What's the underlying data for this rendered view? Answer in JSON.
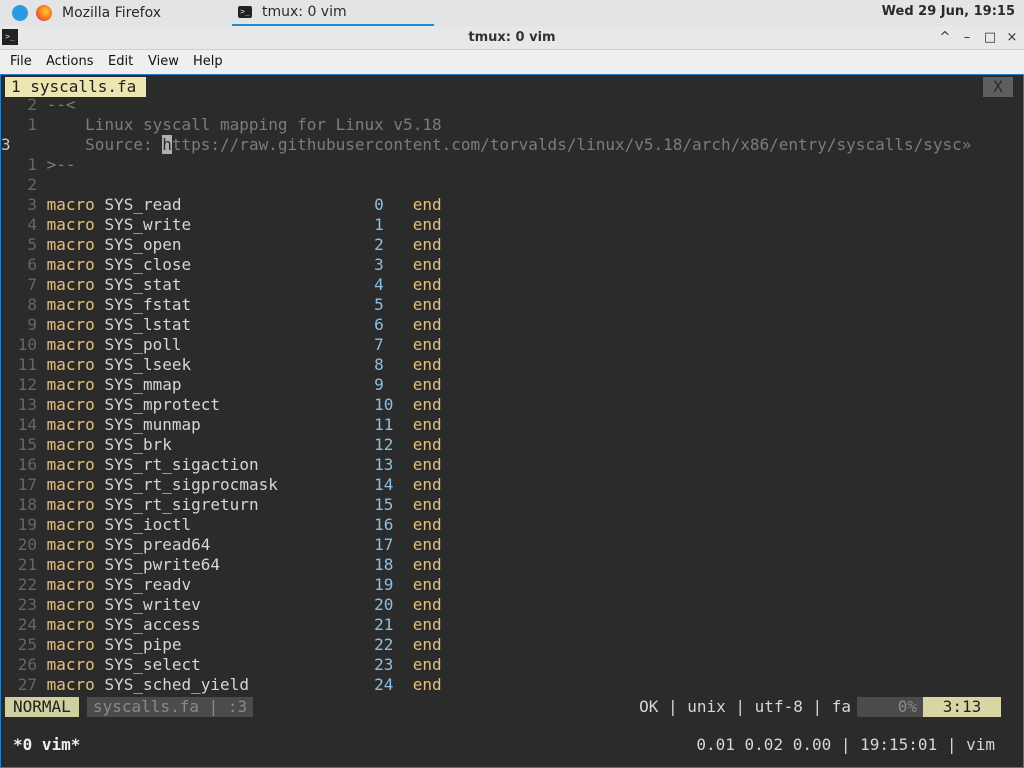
{
  "panel": {
    "task1": "Mozilla Firefox",
    "task2": "tmux: 0 vim",
    "clock": "Wed 29 Jun, 19:15"
  },
  "window": {
    "title": "tmux: 0 vim",
    "minimize": "^",
    "restore": "–",
    "maximize": "□",
    "close": "×"
  },
  "menu": [
    "File",
    "Actions",
    "Edit",
    "View",
    "Help"
  ],
  "vim": {
    "tab_label": "1 syscalls.fa",
    "tab_close": "X",
    "header_lines": [
      {
        "num": "2",
        "text": "--<"
      },
      {
        "num": "1",
        "text": "    Linux syscall mapping for Linux v5.18"
      },
      {
        "num": "3",
        "text": "    Source: https://raw.githubusercontent.com/torvalds/linux/v5.18/arch/x86/entry/syscalls/sysc»",
        "current": true
      },
      {
        "num": "1",
        "text": ">--"
      },
      {
        "num": "2",
        "text": ""
      }
    ],
    "macros": [
      {
        "num": "3",
        "name": "SYS_read",
        "value": "0"
      },
      {
        "num": "4",
        "name": "SYS_write",
        "value": "1"
      },
      {
        "num": "5",
        "name": "SYS_open",
        "value": "2"
      },
      {
        "num": "6",
        "name": "SYS_close",
        "value": "3"
      },
      {
        "num": "7",
        "name": "SYS_stat",
        "value": "4"
      },
      {
        "num": "8",
        "name": "SYS_fstat",
        "value": "5"
      },
      {
        "num": "9",
        "name": "SYS_lstat",
        "value": "6"
      },
      {
        "num": "10",
        "name": "SYS_poll",
        "value": "7"
      },
      {
        "num": "11",
        "name": "SYS_lseek",
        "value": "8"
      },
      {
        "num": "12",
        "name": "SYS_mmap",
        "value": "9"
      },
      {
        "num": "13",
        "name": "SYS_mprotect",
        "value": "10"
      },
      {
        "num": "14",
        "name": "SYS_munmap",
        "value": "11"
      },
      {
        "num": "15",
        "name": "SYS_brk",
        "value": "12"
      },
      {
        "num": "16",
        "name": "SYS_rt_sigaction",
        "value": "13"
      },
      {
        "num": "17",
        "name": "SYS_rt_sigprocmask",
        "value": "14"
      },
      {
        "num": "18",
        "name": "SYS_rt_sigreturn",
        "value": "15"
      },
      {
        "num": "19",
        "name": "SYS_ioctl",
        "value": "16"
      },
      {
        "num": "20",
        "name": "SYS_pread64",
        "value": "17"
      },
      {
        "num": "21",
        "name": "SYS_pwrite64",
        "value": "18"
      },
      {
        "num": "22",
        "name": "SYS_readv",
        "value": "19"
      },
      {
        "num": "23",
        "name": "SYS_writev",
        "value": "20"
      },
      {
        "num": "24",
        "name": "SYS_access",
        "value": "21"
      },
      {
        "num": "25",
        "name": "SYS_pipe",
        "value": "22"
      },
      {
        "num": "26",
        "name": "SYS_select",
        "value": "23"
      },
      {
        "num": "27",
        "name": "SYS_sched_yield",
        "value": "24"
      }
    ],
    "keyword": "macro",
    "end_keyword": "end",
    "status": {
      "mode": "NORMAL",
      "file": "syscalls.fa | :3",
      "info": "OK | unix | utf-8 | fa",
      "percent": "0%",
      "position": "3:13"
    }
  },
  "tmux": {
    "window": "*0 vim*",
    "right": "0.01 0.02 0.00 | 19:15:01 | vim"
  }
}
